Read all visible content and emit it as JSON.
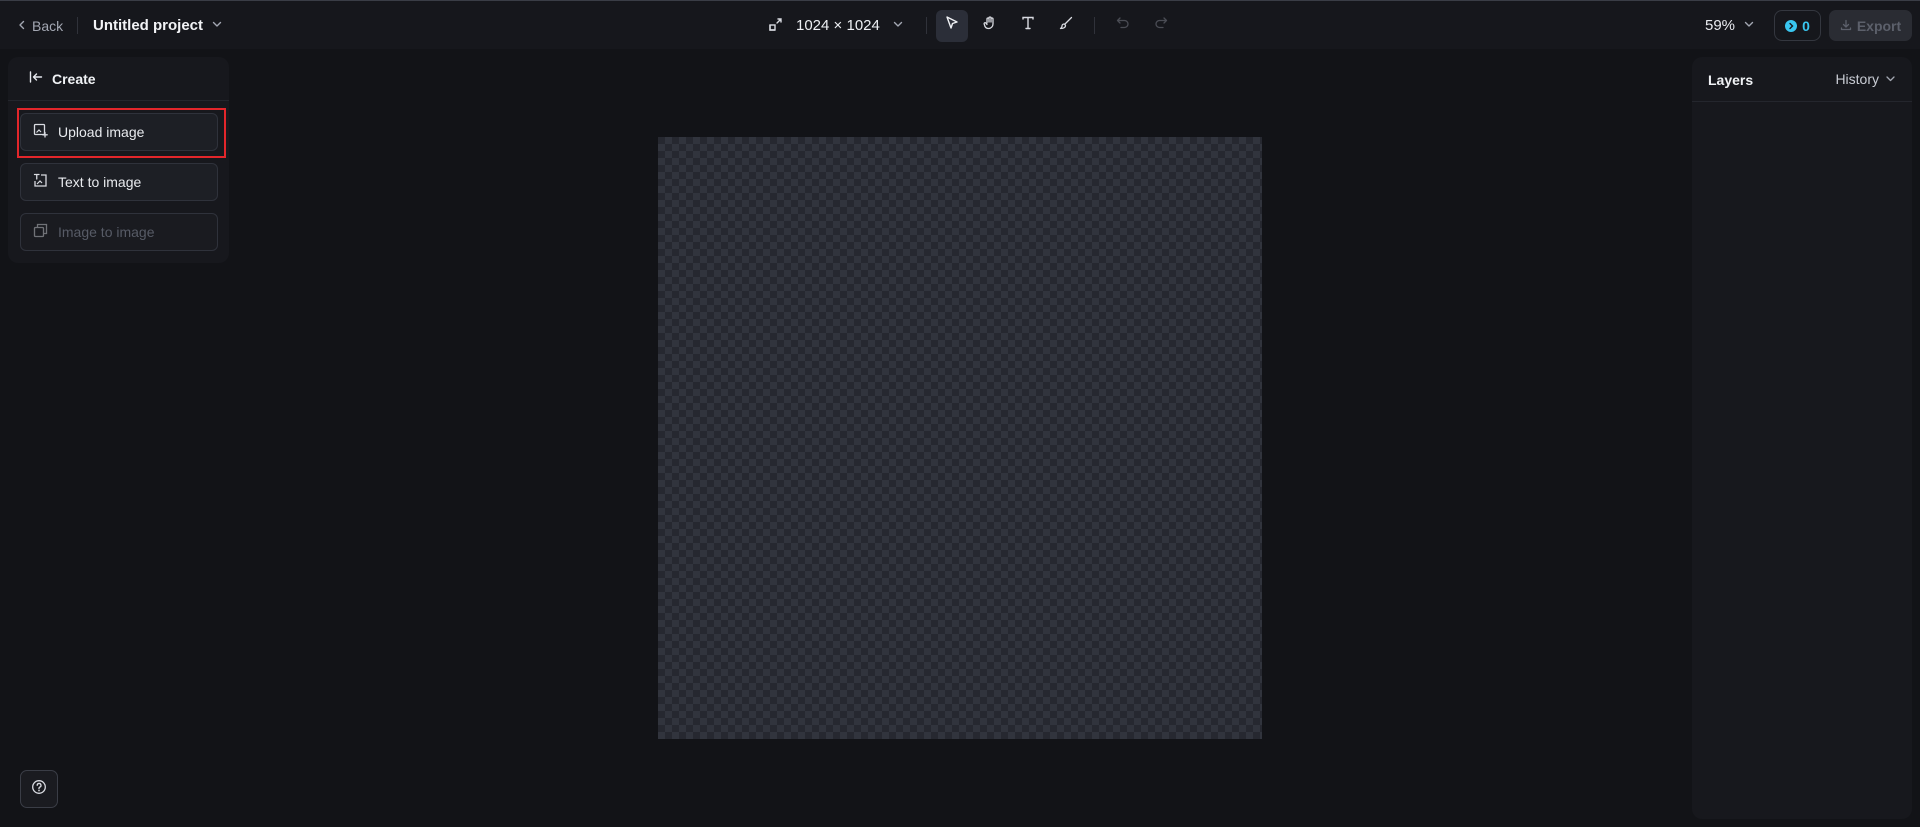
{
  "header": {
    "back_label": "Back",
    "project_title": "Untitled project",
    "canvas_width": "1024",
    "size_separator": "×",
    "canvas_height": "1024",
    "zoom_label": "59%",
    "credits_count": "0",
    "export_label": "Export"
  },
  "tools": [
    {
      "name": "select",
      "icon": "cursor-arrow-icon",
      "active": true
    },
    {
      "name": "hand",
      "icon": "hand-icon",
      "active": false
    },
    {
      "name": "text",
      "icon": "text-icon",
      "active": false
    },
    {
      "name": "brush",
      "icon": "brush-icon",
      "active": false
    },
    {
      "name": "undo",
      "icon": "undo-icon",
      "enabled": false
    },
    {
      "name": "redo",
      "icon": "redo-icon",
      "enabled": false
    }
  ],
  "create_panel": {
    "title": "Create",
    "options": [
      {
        "label": "Upload image",
        "icon": "upload-image-icon",
        "enabled": true,
        "highlighted": true
      },
      {
        "label": "Text to image",
        "icon": "text-to-image-icon",
        "enabled": true
      },
      {
        "label": "Image to image",
        "icon": "image-to-image-icon",
        "enabled": false
      }
    ]
  },
  "right_panel": {
    "layers_label": "Layers",
    "history_label": "History"
  },
  "colors": {
    "background": "#121317",
    "panel": "#17181d",
    "accent": "#39c6f0",
    "highlight_border": "#e3262b"
  }
}
